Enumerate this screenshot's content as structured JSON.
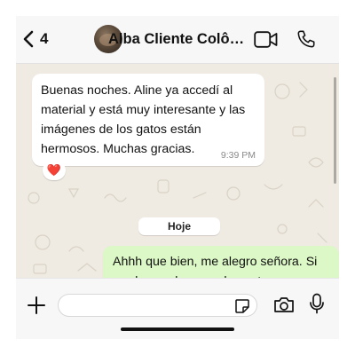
{
  "header": {
    "back_count": "4",
    "contact_name": "Alba Cliente Colô…",
    "icons": [
      "chevron-left-icon",
      "video-call-icon",
      "phone-call-icon"
    ]
  },
  "chat": {
    "incoming": {
      "text": "Buenas noches. Aline ya accedí al material y está muy interesante y las imágenes de los gatos están hermosos. Muchas gracias.",
      "time": "9:39 PM",
      "reaction": "❤️"
    },
    "date_divider": "Hoje",
    "outgoing": {
      "text": "Ahhh que bien, me alegro señora. Si produces algo para los gatos,"
    }
  },
  "input_bar": {
    "placeholder": "",
    "icons": [
      "plus-icon",
      "sticker-icon",
      "camera-icon",
      "microphone-icon"
    ]
  },
  "colors": {
    "wallpaper": "#efeae2",
    "incoming_bubble": "#ffffff",
    "outgoing_bubble": "#dcf8c6",
    "header_bg": "#f7f7f7"
  }
}
